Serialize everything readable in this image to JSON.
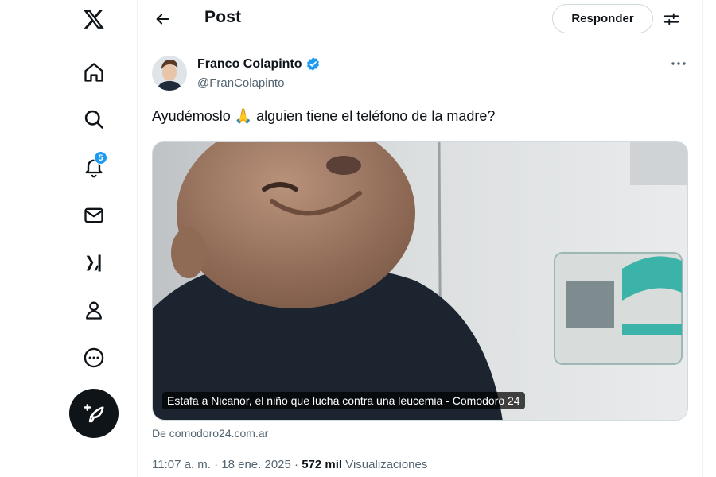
{
  "nav": {
    "items": [
      {
        "icon": "x-logo-icon"
      },
      {
        "icon": "home-icon"
      },
      {
        "icon": "search-icon"
      },
      {
        "icon": "notifications-icon",
        "badge": "5"
      },
      {
        "icon": "messages-icon"
      },
      {
        "icon": "grok-icon"
      },
      {
        "icon": "profile-icon"
      },
      {
        "icon": "more-icon"
      }
    ],
    "compose_icon": "compose-post-icon"
  },
  "header": {
    "title": "Post",
    "reply_label": "Responder"
  },
  "post": {
    "author_name": "Franco Colapinto",
    "author_handle": "@FranColapinto",
    "text": "Ayudémoslo 🙏 alguien tiene el teléfono de la madre?",
    "media_caption": "Estafa a Nicanor, el niño que lucha contra una leucemia - Comodoro 24",
    "media_source": "De comodoro24.com.ar",
    "time": "11:07 a. m. · 18 ene. 2025 · ",
    "views_count": "572 mil",
    "views_label": " Visualizaciones"
  },
  "colors": {
    "accent": "#1d9bf0",
    "text_primary": "#0f1419",
    "text_secondary": "#536471"
  }
}
